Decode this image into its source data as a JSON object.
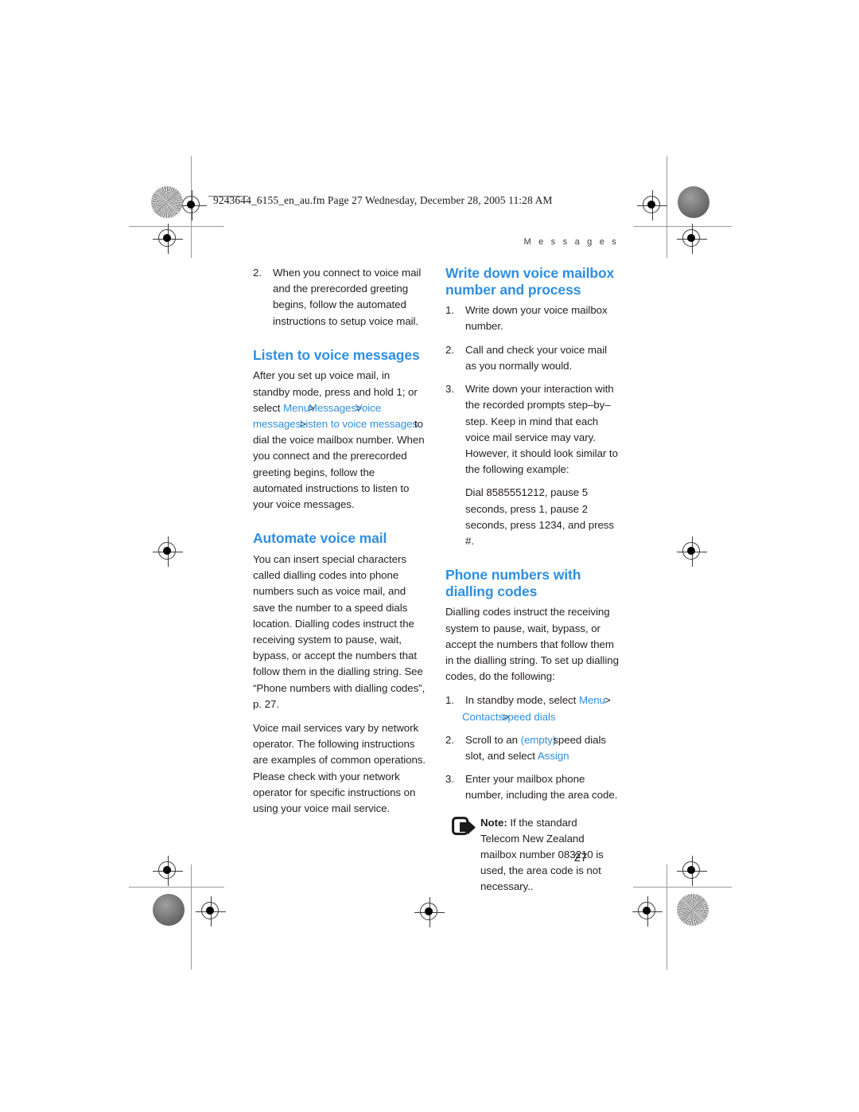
{
  "prepress": {
    "slug_line": "9243644_6155_en_au.fm  Page 27  Wednesday, December 28, 2005  11:28 AM"
  },
  "running_head": "M e s s a g e s",
  "folio": "27",
  "accent_color": "#2e8fe0",
  "text_color": "#231f20",
  "left_column": {
    "step_2": {
      "num": "2.",
      "text": "When you connect to voice mail and the prerecorded greeting begins, follow the automated instructions to setup voice mail."
    },
    "listen_heading": "Listen to voice messages",
    "listen_p1_a": "After you set up voice mail, in standby mode, press and hold 1; or select ",
    "listen_ui_1": "Menu",
    "listen_chev_1": ">",
    "listen_ui_2": "Messages",
    "listen_chev_2": ">",
    "listen_ui_3": "Voice messages",
    "listen_chev_3": ">",
    "listen_ui_4": "Listen to voice messages",
    "listen_p1_b": "to dial the voice mailbox number. When you connect and the prerecorded greeting begins, follow the automated instructions to listen to your voice messages.",
    "automate_heading": "Automate voice mail",
    "automate_p1": "You can insert special characters called dialling codes into phone numbers such as voice mail, and save the number to a speed dials location. Dialling codes instruct the receiving system to pause, wait, bypass, or accept the numbers that follow them in the dialling string. See “Phone numbers with dialling codes”, p. 27.",
    "automate_p2": "Voice mail services vary by network operator. The following instructions are examples of common operations. Please check with your network operator for specific instructions on using your voice mail service."
  },
  "right_column": {
    "write_heading": "Write down voice mailbox number and process",
    "write_steps": [
      {
        "num": "1.",
        "text": "Write down your voice mailbox number."
      },
      {
        "num": "2.",
        "text": "Call and check your voice mail as you normally would."
      },
      {
        "num": "3.",
        "text": "Write down your interaction with the recorded prompts step–by–step. Keep in mind that each voice mail service may vary. However, it should look similar to the following example:"
      }
    ],
    "example_text": "Dial 8585551212, pause 5 seconds, press 1, pause 2 seconds, press 1234, and press #.",
    "dialling_heading": "Phone numbers with dialling codes",
    "dialling_p1": "Dialling codes instruct the receiving system to pause, wait, bypass, or accept the numbers that follow them in the dialling string. To set up dialling codes, do the following:",
    "step1_num": "1.",
    "step1_a": "In standby mode, select ",
    "step1_ui_1": "Menu",
    "step1_chev_1": ">",
    "step1_ui_2": "Contacts",
    "step1_chev_2": ">",
    "step1_ui_3": "speed dials",
    "step2_num": "2.",
    "step2_a": "Scroll to an ",
    "step2_ui_1": "(empty)",
    "step2_b": "speed dials slot, and select ",
    "step2_ui_2": "Assign",
    "step3_num": "3.",
    "step3_text": "Enter your mailbox phone number, including the area code.",
    "note": {
      "icon": "note-arrow-icon",
      "label": "Note:",
      "text": " If the standard Telecom New Zealand mailbox number 083210 is used, the area code is not necessary.."
    }
  }
}
